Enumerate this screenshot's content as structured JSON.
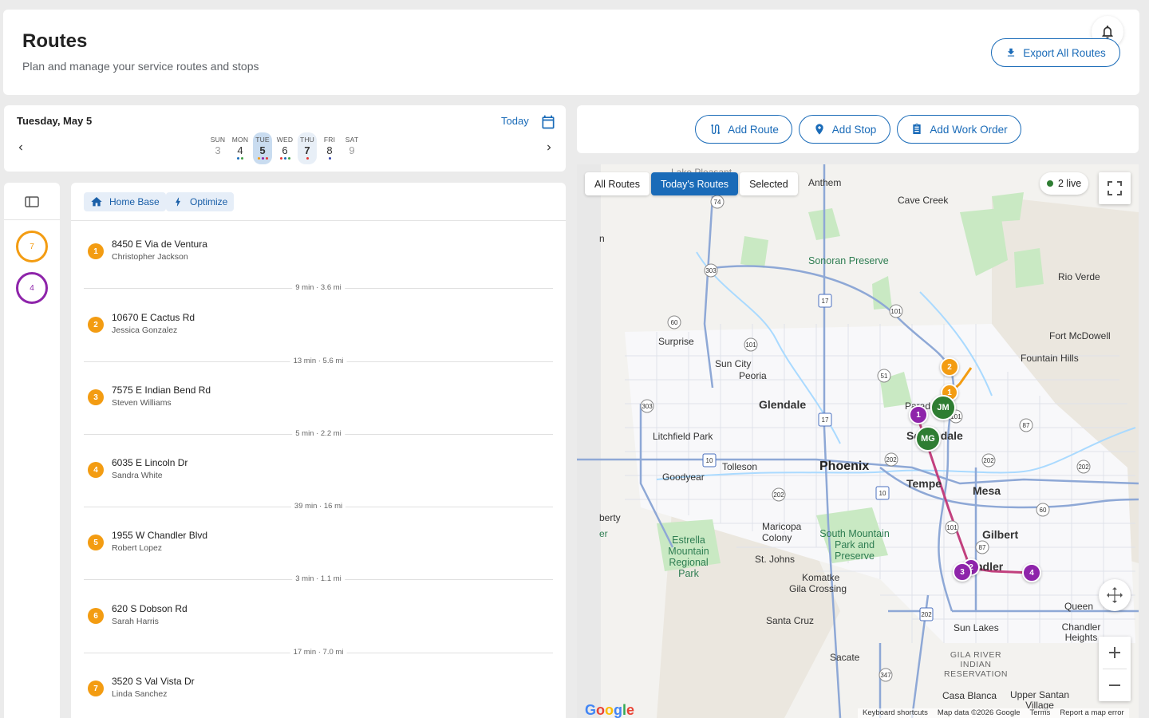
{
  "header": {
    "title": "Routes",
    "subtitle": "Plan and manage your service routes and stops",
    "export_label": "Export All Routes",
    "notifications_icon": "bell-icon"
  },
  "calendar": {
    "current_date": "Tuesday, May 5",
    "today_label": "Today",
    "days": [
      {
        "name": "SUN",
        "date": "3"
      },
      {
        "name": "MON",
        "date": "4"
      },
      {
        "name": "TUE",
        "date": "5"
      },
      {
        "name": "WED",
        "date": "6"
      },
      {
        "name": "THU",
        "date": "7"
      },
      {
        "name": "FRI",
        "date": "8"
      },
      {
        "name": "SAT",
        "date": "9"
      }
    ]
  },
  "actions": {
    "add_route": "Add Route",
    "add_stop": "Add Stop",
    "add_work_order": "Add Work Order"
  },
  "routes_rail": {
    "routes": [
      {
        "count": "7",
        "color": "#f39c12"
      },
      {
        "count": "4",
        "color": "#8e24aa"
      }
    ]
  },
  "toolbar": {
    "home_base": "Home Base",
    "optimize": "Optimize"
  },
  "stops": [
    {
      "num": "1",
      "address": "8450 E Via de Ventura",
      "contact": "Christopher Jackson"
    },
    {
      "num": "2",
      "address": "10670 E Cactus Rd",
      "contact": "Jessica Gonzalez"
    },
    {
      "num": "3",
      "address": "7575 E Indian Bend Rd",
      "contact": "Steven Williams"
    },
    {
      "num": "4",
      "address": "6035 E Lincoln Dr",
      "contact": "Sandra White"
    },
    {
      "num": "5",
      "address": "1955 W Chandler Blvd",
      "contact": "Robert Lopez"
    },
    {
      "num": "6",
      "address": "620 S Dobson Rd",
      "contact": "Sarah Harris"
    },
    {
      "num": "7",
      "address": "3520 S Val Vista Dr",
      "contact": "Linda Sanchez"
    }
  ],
  "legs": [
    "9 min · 3.6 mi",
    "13 min · 5.6 mi",
    "5 min · 2.2 mi",
    "39 min · 16 mi",
    "3 min · 1.1 mi",
    "17 min · 7.0 mi"
  ],
  "map": {
    "filters": [
      "All Routes",
      "Today's Routes",
      "Selected"
    ],
    "active_filter": "Today's Routes",
    "live_label": "2 live",
    "places": {
      "anthem": "Anthem",
      "cave_creek": "Cave Creek",
      "lake_pleasant": "Lake Pleasant",
      "sonoran": "Sonoran Preserve",
      "rio_verde": "Rio Verde",
      "fort_mcdowell": "Fort McDowell",
      "fountain_hills": "Fountain Hills",
      "surprise": "Surprise",
      "sun_city": "Sun City",
      "peoria": "Peoria",
      "glendale": "Glendale",
      "scottsdale": "Scottsdale",
      "paradise": "Parad",
      "litchfield": "Litchfield Park",
      "tolleson": "Tolleson",
      "phoenix": "Phoenix",
      "tempe": "Tempe",
      "mesa": "Mesa",
      "goodyear": "Goodyear",
      "gilbert": "Gilbert",
      "buckeye": "berty",
      "maricopa_colony": "Maricopa Colony",
      "south_mountain": "South Mountain Park and Preserve",
      "estrella": "Estrella Mountain Regional Park",
      "st_johns": "St. Johns",
      "chandler": "ndler",
      "komatke": "Komatke",
      "gila_crossing": "Gila Crossing",
      "santa_cruz": "Santa Cruz",
      "sun_lakes": "Sun Lakes",
      "queen_creek": "Queen",
      "chandler_heights": "Chandler Heights",
      "sacate": "Sacate",
      "gila_river": "GILA RIVER INDIAN RESERVATION",
      "casa_blanca": "Casa Blanca",
      "upper_santan": "Upper Santan Village",
      "left_n": "n",
      "left_er": "er"
    },
    "shields": [
      "74",
      "303",
      "17",
      "60",
      "101",
      "101",
      "51",
      "303",
      "17",
      "10",
      "202",
      "101",
      "87",
      "202",
      "60",
      "202",
      "202",
      "87",
      "10",
      "347",
      "202",
      "101"
    ],
    "pins": {
      "orange_1": "1",
      "orange_2": "2",
      "driver_jm": "JM",
      "driver_mg": "MG",
      "purple_1": "1",
      "purple_2": "2",
      "purple_3": "3",
      "purple_4": "4"
    },
    "google": "Google",
    "footer": [
      "Keyboard shortcuts",
      "Map data ©2026 Google",
      "Terms",
      "Report a map error"
    ],
    "route_colors": {
      "orange": "#f39c12",
      "purple": "#8e24aa",
      "driver": "#2e7d32",
      "route_line": "#c2407e"
    }
  }
}
